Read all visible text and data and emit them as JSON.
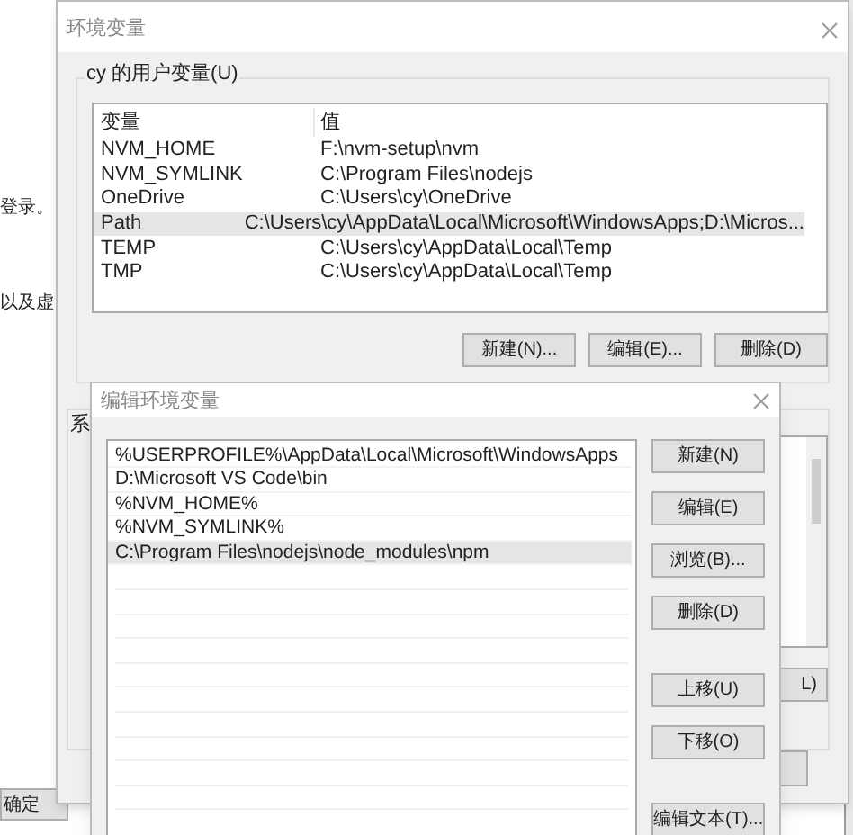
{
  "background_window": {
    "texts": [
      "登录。",
      "以及虚"
    ],
    "button": "确定"
  },
  "env_dialog": {
    "title": "环境变量",
    "user_group": "cy 的用户变量(U)",
    "columns": [
      "变量",
      "值"
    ],
    "rows": [
      {
        "name": "NVM_HOME",
        "value": "F:\\nvm-setup\\nvm",
        "selected": false
      },
      {
        "name": "NVM_SYMLINK",
        "value": "C:\\Program Files\\nodejs",
        "selected": false
      },
      {
        "name": "OneDrive",
        "value": "C:\\Users\\cy\\OneDrive",
        "selected": false
      },
      {
        "name": "Path",
        "value": "C:\\Users\\cy\\AppData\\Local\\Microsoft\\WindowsApps;D:\\Micros...",
        "selected": true
      },
      {
        "name": "TEMP",
        "value": "C:\\Users\\cy\\AppData\\Local\\Temp",
        "selected": false
      },
      {
        "name": "TMP",
        "value": "C:\\Users\\cy\\AppData\\Local\\Temp",
        "selected": false
      }
    ],
    "buttons": [
      "新建(N)...",
      "编辑(E)...",
      "删除(D)"
    ],
    "system_group": "系",
    "system_button": "L)"
  },
  "edit_dialog": {
    "title": "编辑环境变量",
    "items": [
      {
        "text": "%USERPROFILE%\\AppData\\Local\\Microsoft\\WindowsApps",
        "selected": false
      },
      {
        "text": "D:\\Microsoft VS Code\\bin",
        "selected": false
      },
      {
        "text": "%NVM_HOME%",
        "selected": false
      },
      {
        "text": "%NVM_SYMLINK%",
        "selected": false
      },
      {
        "text": "C:\\Program Files\\nodejs\\node_modules\\npm",
        "selected": true
      }
    ],
    "buttons": [
      {
        "label": "新建(N)",
        "kind": "button"
      },
      {
        "label": "编辑(E)",
        "kind": "button"
      },
      {
        "label": "浏览(B)...",
        "kind": "button"
      },
      {
        "label": "删除(D)",
        "kind": "button"
      },
      {
        "label": "上移(U)",
        "kind": "spaced"
      },
      {
        "label": "下移(O)",
        "kind": "button"
      },
      {
        "label": "编辑文本(T)...",
        "kind": "spaced"
      }
    ]
  }
}
